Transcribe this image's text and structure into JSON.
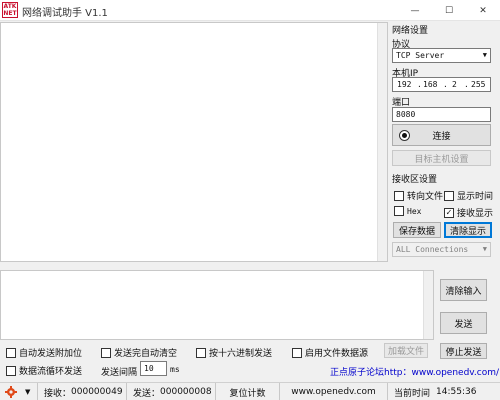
{
  "window": {
    "title": "网络调试助手 V1.1",
    "logo_text": "ATK\nNET",
    "minimize_glyph": "—",
    "maximize_glyph": "☐",
    "close_glyph": "✕"
  },
  "net_settings": {
    "group_title": "网络设置",
    "protocol_label": "协议",
    "protocol_value": "TCP Server",
    "local_ip_label": "本机IP",
    "ip_parts": [
      "192",
      "168",
      "2",
      "255"
    ],
    "port_label": "端口",
    "port_value": "8080",
    "connect_label": "连接",
    "target_host_label": "目标主机设置"
  },
  "recv_settings": {
    "group_title": "接收区设置",
    "to_file_label": "转向文件",
    "show_time_label": "显示时间",
    "hex_label": "Hex",
    "recv_display_label": "接收显示",
    "save_data_label": "保存数据",
    "clear_display_label": "清除显示",
    "connections_value": "ALL Connections",
    "to_file_checked": false,
    "show_time_checked": false,
    "hex_checked": false,
    "recv_display_checked": true
  },
  "send": {
    "clear_input_label": "清除输入",
    "send_label": "发送",
    "auto_append_label": "自动发送附加位",
    "auto_clear_label": "发送完自动清空",
    "hex_send_label": "按十六进制发送",
    "file_source_label": "启用文件数据源",
    "load_file_label": "加载文件",
    "stop_send_label": "停止发送",
    "loop_send_label": "数据流循环发送",
    "interval_label": "发送间隔",
    "interval_value": "10",
    "interval_unit": "ms"
  },
  "forum_link": "正点原子论坛http：www.openedv.com/",
  "status": {
    "recv_label": "接收：",
    "recv_count": "000000049",
    "send_label": "发送：",
    "send_count": "000000008",
    "reset_label": "复位计数",
    "website": "www.openedv.com",
    "time_label": "当前时间",
    "time_value": "14:55:36"
  },
  "colors": {
    "accent": "#0078d7",
    "link": "#0000cc",
    "gear": "#e04a1a",
    "logo": "#c8102e"
  }
}
